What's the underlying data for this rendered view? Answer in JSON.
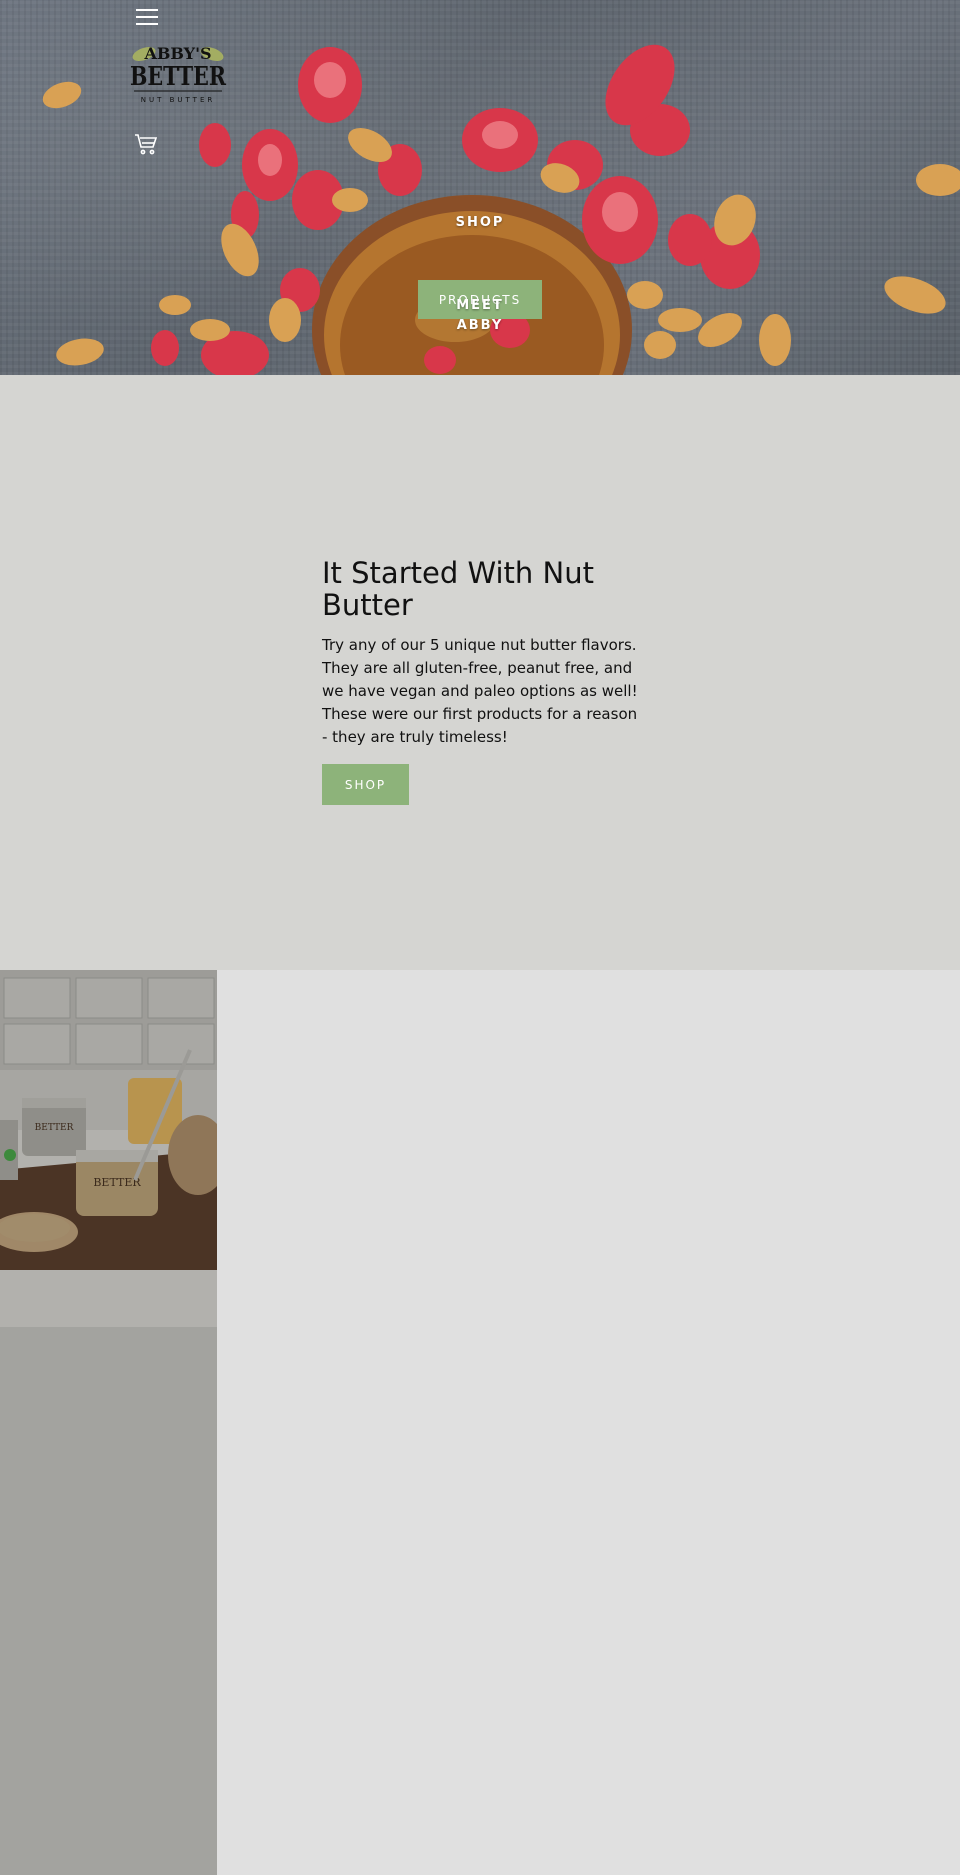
{
  "header": {
    "menu_icon": "hamburger-menu-icon",
    "cart_icon": "shopping-cart-icon",
    "logo": {
      "line1": "ABBY'S",
      "line2": "BETTER",
      "line3": "NUT BUTTER"
    }
  },
  "nav": {
    "shop_label": "SHOP",
    "products_label": "PRODUCTS",
    "meet_line1": "MEET",
    "meet_line2": "ABBY"
  },
  "feature": {
    "title": "It Started With Nut Butter",
    "body": "Try any of our 5 unique nut butter flavors. They are all gluten-free, peanut free, and we have vegan and paleo options as well! These were our first products for a reason - they are truly timeless!",
    "button_label": "SHOP"
  },
  "colors": {
    "accent": "#8db37a",
    "feature_bg": "#d5d5d2",
    "lower_left_bg": "#a3a39f",
    "lower_right_bg": "#e0e0e0"
  }
}
